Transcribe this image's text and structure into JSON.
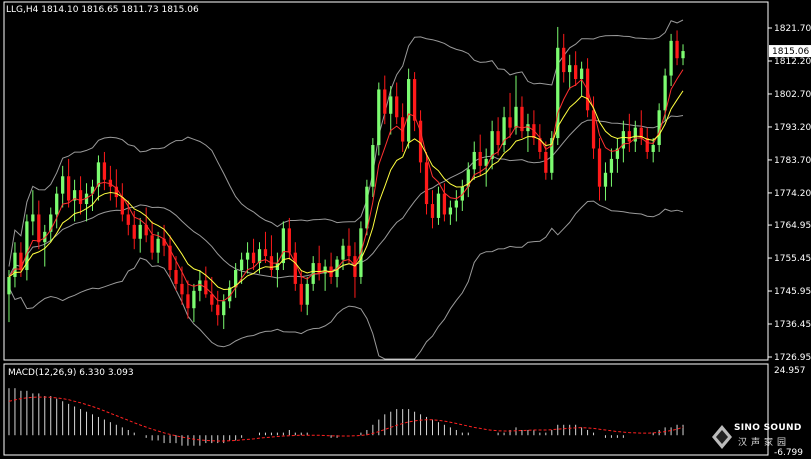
{
  "header": {
    "symbol": "LLG,H4",
    "ohlc": "1814.10 1816.65 1811.73 1815.06"
  },
  "macd_label": "MACD(12,26,9) 6.330 3.093",
  "logo": {
    "name": "SINO SOUND",
    "subtitle": "汉声家园"
  },
  "colors": {
    "background": "#000000",
    "bull": "#7CFC70",
    "bear": "#FF1A1A",
    "ma_fast": "#FF3030",
    "ma_slow": "#FFFF40",
    "bands": "#9A9A9A",
    "macd_signal": "#FF2020",
    "macd_hist": "#D8D8D8",
    "price_tag": "#FFFFFF"
  },
  "chart_data": {
    "type": "candlestick",
    "timeframe": "H4",
    "current_price": "1815.06",
    "y_ticks": [
      "1821.70",
      "1812.20",
      "1802.70",
      "1793.20",
      "1783.70",
      "1774.20",
      "1764.95",
      "1755.45",
      "1745.95",
      "1736.45",
      "1726.95"
    ],
    "ylim": [
      1726.95,
      1821.7
    ],
    "candles": [
      [
        1745.0,
        1752.0,
        1737.0,
        1750.0
      ],
      [
        1750.0,
        1760.0,
        1747.0,
        1757.0
      ],
      [
        1757.0,
        1760.0,
        1750.0,
        1752.0
      ],
      [
        1752.0,
        1768.0,
        1749.0,
        1766.0
      ],
      [
        1766.0,
        1775.0,
        1762.0,
        1768.0
      ],
      [
        1768.0,
        1772.0,
        1758.0,
        1760.0
      ],
      [
        1760.0,
        1765.0,
        1753.0,
        1763.0
      ],
      [
        1763.0,
        1770.0,
        1760.0,
        1768.0
      ],
      [
        1768.0,
        1776.0,
        1764.0,
        1774.0
      ],
      [
        1774.0,
        1782.0,
        1770.0,
        1779.0
      ],
      [
        1779.0,
        1784.0,
        1770.0,
        1772.0
      ],
      [
        1772.0,
        1778.0,
        1766.0,
        1775.0
      ],
      [
        1775.0,
        1779.0,
        1768.0,
        1771.0
      ],
      [
        1771.0,
        1777.0,
        1766.0,
        1774.0
      ],
      [
        1774.0,
        1778.0,
        1769.0,
        1776.0
      ],
      [
        1776.0,
        1785.0,
        1772.0,
        1783.0
      ],
      [
        1783.0,
        1786.0,
        1775.0,
        1778.0
      ],
      [
        1778.0,
        1782.0,
        1772.0,
        1776.0
      ],
      [
        1776.0,
        1781.0,
        1770.0,
        1773.0
      ],
      [
        1773.0,
        1777.0,
        1766.0,
        1768.0
      ],
      [
        1768.0,
        1772.0,
        1762.0,
        1765.0
      ],
      [
        1765.0,
        1769.0,
        1758.0,
        1761.0
      ],
      [
        1761.0,
        1767.0,
        1757.0,
        1765.0
      ],
      [
        1765.0,
        1770.0,
        1760.0,
        1762.0
      ],
      [
        1762.0,
        1766.0,
        1755.0,
        1757.0
      ],
      [
        1757.0,
        1763.0,
        1754.0,
        1761.0
      ],
      [
        1761.0,
        1765.0,
        1756.0,
        1759.0
      ],
      [
        1759.0,
        1762.0,
        1750.0,
        1752.0
      ],
      [
        1752.0,
        1756.0,
        1746.0,
        1748.0
      ],
      [
        1748.0,
        1753.0,
        1742.0,
        1745.0
      ],
      [
        1745.0,
        1749.0,
        1738.0,
        1741.0
      ],
      [
        1741.0,
        1748.0,
        1737.0,
        1746.0
      ],
      [
        1746.0,
        1752.0,
        1743.0,
        1749.0
      ],
      [
        1749.0,
        1753.0,
        1744.0,
        1745.0
      ],
      [
        1745.0,
        1750.0,
        1740.0,
        1742.0
      ],
      [
        1742.0,
        1746.0,
        1736.0,
        1739.0
      ],
      [
        1739.0,
        1745.0,
        1735.0,
        1743.0
      ],
      [
        1743.0,
        1749.0,
        1741.0,
        1747.0
      ],
      [
        1747.0,
        1754.0,
        1744.0,
        1752.0
      ],
      [
        1752.0,
        1757.0,
        1748.0,
        1755.0
      ],
      [
        1755.0,
        1760.0,
        1751.0,
        1757.0
      ],
      [
        1757.0,
        1761.0,
        1752.0,
        1754.0
      ],
      [
        1754.0,
        1760.0,
        1751.0,
        1758.0
      ],
      [
        1758.0,
        1763.0,
        1754.0,
        1756.0
      ],
      [
        1756.0,
        1762.0,
        1750.0,
        1752.0
      ],
      [
        1752.0,
        1757.0,
        1747.0,
        1754.0
      ],
      [
        1754.0,
        1766.0,
        1752.0,
        1764.0
      ],
      [
        1764.0,
        1767.0,
        1755.0,
        1757.0
      ],
      [
        1757.0,
        1760.0,
        1746.0,
        1748.0
      ],
      [
        1748.0,
        1752.0,
        1740.0,
        1742.0
      ],
      [
        1742.0,
        1750.0,
        1739.0,
        1748.0
      ],
      [
        1748.0,
        1756.0,
        1746.0,
        1754.0
      ],
      [
        1754.0,
        1759.0,
        1749.0,
        1751.0
      ],
      [
        1751.0,
        1755.0,
        1746.0,
        1753.0
      ],
      [
        1753.0,
        1757.0,
        1748.0,
        1750.0
      ],
      [
        1750.0,
        1756.0,
        1747.0,
        1755.0
      ],
      [
        1755.0,
        1761.0,
        1752.0,
        1759.0
      ],
      [
        1759.0,
        1764.0,
        1754.0,
        1756.0
      ],
      [
        1756.0,
        1760.0,
        1744.0,
        1750.0
      ],
      [
        1750.0,
        1766.0,
        1748.0,
        1764.0
      ],
      [
        1764.0,
        1778.0,
        1762.0,
        1776.0
      ],
      [
        1776.0,
        1790.0,
        1773.0,
        1788.0
      ],
      [
        1788.0,
        1806.0,
        1785.0,
        1804.0
      ],
      [
        1804.0,
        1808.0,
        1794.0,
        1797.0
      ],
      [
        1797.0,
        1805.0,
        1791.0,
        1802.0
      ],
      [
        1802.0,
        1806.0,
        1794.0,
        1796.0
      ],
      [
        1796.0,
        1800.0,
        1786.0,
        1789.0
      ],
      [
        1789.0,
        1810.0,
        1787.0,
        1807.0
      ],
      [
        1807.0,
        1809.0,
        1792.0,
        1795.0
      ],
      [
        1795.0,
        1798.0,
        1780.0,
        1783.0
      ],
      [
        1783.0,
        1786.0,
        1768.0,
        1771.0
      ],
      [
        1771.0,
        1775.0,
        1764.0,
        1767.0
      ],
      [
        1767.0,
        1776.0,
        1765.0,
        1774.0
      ],
      [
        1774.0,
        1777.0,
        1766.0,
        1768.0
      ],
      [
        1768.0,
        1772.0,
        1765.0,
        1770.0
      ],
      [
        1770.0,
        1775.0,
        1766.0,
        1772.0
      ],
      [
        1772.0,
        1778.0,
        1769.0,
        1776.0
      ],
      [
        1776.0,
        1783.0,
        1773.0,
        1781.0
      ],
      [
        1781.0,
        1789.0,
        1778.0,
        1786.0
      ],
      [
        1786.0,
        1791.0,
        1779.0,
        1782.0
      ],
      [
        1782.0,
        1787.0,
        1776.0,
        1784.0
      ],
      [
        1784.0,
        1795.0,
        1781.0,
        1792.0
      ],
      [
        1792.0,
        1796.0,
        1785.0,
        1788.0
      ],
      [
        1788.0,
        1799.0,
        1786.0,
        1796.0
      ],
      [
        1796.0,
        1803.0,
        1790.0,
        1793.0
      ],
      [
        1793.0,
        1808.0,
        1791.0,
        1799.0
      ],
      [
        1799.0,
        1802.0,
        1790.0,
        1792.0
      ],
      [
        1792.0,
        1797.0,
        1786.0,
        1794.0
      ],
      [
        1794.0,
        1798.0,
        1788.0,
        1790.0
      ],
      [
        1790.0,
        1794.0,
        1784.0,
        1786.0
      ],
      [
        1786.0,
        1789.0,
        1778.0,
        1780.0
      ],
      [
        1780.0,
        1792.0,
        1778.0,
        1790.0
      ],
      [
        1790.0,
        1822.0,
        1788.0,
        1816.0
      ],
      [
        1816.0,
        1820.0,
        1806.0,
        1809.0
      ],
      [
        1809.0,
        1814.0,
        1804.0,
        1811.0
      ],
      [
        1811.0,
        1815.0,
        1805.0,
        1807.0
      ],
      [
        1807.0,
        1812.0,
        1802.0,
        1810.0
      ],
      [
        1810.0,
        1813.0,
        1796.0,
        1798.0
      ],
      [
        1798.0,
        1802.0,
        1784.0,
        1787.0
      ],
      [
        1787.0,
        1790.0,
        1772.0,
        1776.0
      ],
      [
        1776.0,
        1783.0,
        1772.0,
        1780.0
      ],
      [
        1780.0,
        1787.0,
        1776.0,
        1784.0
      ],
      [
        1784.0,
        1790.0,
        1780.0,
        1787.0
      ],
      [
        1787.0,
        1795.0,
        1783.0,
        1792.0
      ],
      [
        1792.0,
        1797.0,
        1786.0,
        1789.0
      ],
      [
        1789.0,
        1795.0,
        1786.0,
        1793.0
      ],
      [
        1793.0,
        1798.0,
        1788.0,
        1790.0
      ],
      [
        1790.0,
        1793.0,
        1784.0,
        1786.0
      ],
      [
        1786.0,
        1790.0,
        1783.0,
        1788.0
      ],
      [
        1788.0,
        1800.0,
        1786.0,
        1798.0
      ],
      [
        1798.0,
        1810.0,
        1795.0,
        1808.0
      ],
      [
        1808.0,
        1820.0,
        1805.0,
        1818.0
      ],
      [
        1818.0,
        1821.0,
        1811.0,
        1813.0
      ],
      [
        1813.0,
        1817.0,
        1811.0,
        1815.06
      ]
    ],
    "macd": {
      "label": "MACD(12,26,9)",
      "macd_value": "6.330",
      "signal_value": "3.093",
      "ylim": [
        -6.799,
        24.957
      ],
      "y_ticks": [
        "24.957",
        "-6.799"
      ],
      "histogram": [
        18,
        18,
        17,
        17,
        16,
        16,
        15,
        15,
        14,
        13,
        12,
        11,
        10,
        9,
        8,
        7,
        6,
        5,
        4,
        3,
        2,
        1,
        0,
        -1,
        -2,
        -2,
        -3,
        -3,
        -3,
        -4,
        -4,
        -4,
        -4,
        -3,
        -3,
        -3,
        -3,
        -2,
        -2,
        -1,
        0,
        0,
        1,
        1,
        1,
        1,
        1,
        2,
        1,
        1,
        1,
        0,
        0,
        0,
        -1,
        -1,
        0,
        0,
        0,
        1,
        2,
        4,
        6,
        8,
        9,
        10,
        10,
        10,
        9,
        8,
        7,
        6,
        5,
        4,
        3,
        2,
        1,
        1,
        0,
        0,
        0,
        0,
        1,
        1,
        2,
        3,
        2,
        2,
        2,
        1,
        1,
        2,
        4,
        4,
        4,
        4,
        3,
        2,
        1,
        0,
        -1,
        -1,
        -1,
        -1,
        0,
        0,
        0,
        0,
        1,
        2,
        3,
        3,
        4,
        4
      ],
      "signal": [
        13,
        13.5,
        14,
        14.3,
        14.5,
        14.6,
        14.6,
        14.5,
        14.3,
        14,
        13.6,
        13,
        12.4,
        11.7,
        11,
        10.2,
        9.3,
        8.4,
        7.5,
        6.6,
        5.7,
        4.8,
        3.9,
        3.1,
        2.3,
        1.6,
        0.9,
        0.3,
        -0.2,
        -0.7,
        -1.1,
        -1.5,
        -1.8,
        -2,
        -2.1,
        -2.2,
        -2.2,
        -2.1,
        -2,
        -1.8,
        -1.6,
        -1.4,
        -1.1,
        -0.9,
        -0.7,
        -0.5,
        -0.3,
        -0.2,
        -0.1,
        0,
        0,
        0,
        0,
        -0.1,
        -0.2,
        -0.3,
        -0.3,
        -0.3,
        -0.2,
        -0.1,
        0.2,
        0.7,
        1.4,
        2.2,
        3,
        3.8,
        4.5,
        5.1,
        5.5,
        5.8,
        5.9,
        5.9,
        5.7,
        5.4,
        5,
        4.5,
        4,
        3.5,
        3,
        2.6,
        2.2,
        1.9,
        1.7,
        1.6,
        1.6,
        1.7,
        1.8,
        1.9,
        2,
        2,
        2,
        2.1,
        2.3,
        2.5,
        2.7,
        2.8,
        2.9,
        2.8,
        2.6,
        2.3,
        2,
        1.7,
        1.4,
        1.2,
        1,
        0.9,
        0.8,
        0.8,
        0.9,
        1.1,
        1.4,
        1.8,
        2.3,
        3.1
      ]
    }
  }
}
